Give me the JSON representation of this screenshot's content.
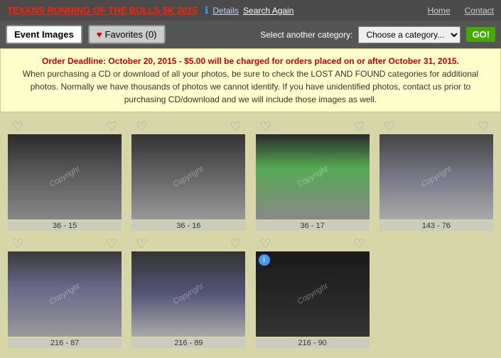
{
  "header": {
    "event_title": "TEXANS RUNNING OF THE BULLS 5K 2015",
    "info_icon": "ℹ",
    "details_label": "Details",
    "search_again_label": "Search Again",
    "nav": {
      "home": "Home",
      "contact": "Contact"
    }
  },
  "tabs": {
    "event_images_label": "Event Images",
    "favorites_label": "Favorites (0)",
    "category_label": "Select another category:",
    "category_placeholder": "Choose a category...",
    "go_label": "GO!"
  },
  "notice": {
    "line1": "Order Deadline: October 20, 2015 - $5.00 will be charged for orders placed on or after October 31, 2015.",
    "line2": "When purchasing a CD or download of all your photos, be sure to check the LOST AND FOUND categories for additional photos. Normally we have thousands of photos we cannot identify. If you have unidentified photos, contact us prior to purchasing CD/download and we will include those images as well."
  },
  "photos": [
    {
      "id": "photo-1",
      "label": "36 - 15",
      "has_info": false,
      "sim_class": "photo-sim-1"
    },
    {
      "id": "photo-2",
      "label": "36 - 16",
      "has_info": false,
      "sim_class": "photo-sim-2"
    },
    {
      "id": "photo-3",
      "label": "36 - 17",
      "has_info": false,
      "sim_class": "photo-sim-3"
    },
    {
      "id": "photo-4",
      "label": "143 - 76",
      "has_info": false,
      "sim_class": "photo-sim-4"
    },
    {
      "id": "photo-5",
      "label": "216 - 87",
      "has_info": false,
      "sim_class": "photo-sim-5"
    },
    {
      "id": "photo-6",
      "label": "216 - 89",
      "has_info": false,
      "sim_class": "photo-sim-6"
    },
    {
      "id": "photo-7",
      "label": "216 - 90",
      "has_info": true,
      "sim_class": "photo-sim-8"
    }
  ],
  "icons": {
    "heart_empty": "♡",
    "heart_filled": "♥",
    "info": "i",
    "copyright": "Copyright"
  }
}
